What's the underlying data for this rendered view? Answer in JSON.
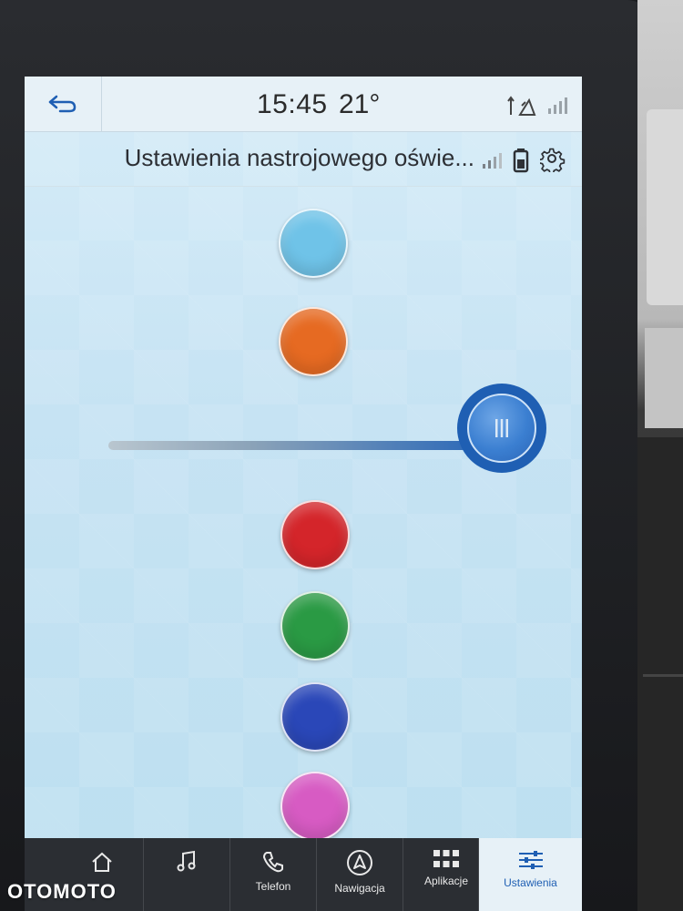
{
  "status_bar": {
    "time": "15:45",
    "temperature": "21°"
  },
  "header": {
    "title": "Ustawienia nastrojowego oświe..."
  },
  "color_swatches": [
    {
      "name": "light-blue",
      "color": "#6fc3e8"
    },
    {
      "name": "orange",
      "color": "#e66a22"
    },
    {
      "name": "red",
      "color": "#d4252a"
    },
    {
      "name": "green",
      "color": "#2a9a44"
    },
    {
      "name": "blue",
      "color": "#2a47b8"
    },
    {
      "name": "pink",
      "color": "#d75bc3"
    }
  ],
  "brightness_slider": {
    "value_fraction": 1.0
  },
  "nav": {
    "home": "",
    "music": "",
    "phone": "Telefon",
    "navigation": "Nawigacja",
    "apps": "Aplikacje",
    "settings": "Ustawienia"
  },
  "watermark": "OTOMOTO",
  "colors": {
    "accent": "#1f5fb3",
    "nav_background": "#2b2e33",
    "screen_background": "#c6e3f3"
  }
}
